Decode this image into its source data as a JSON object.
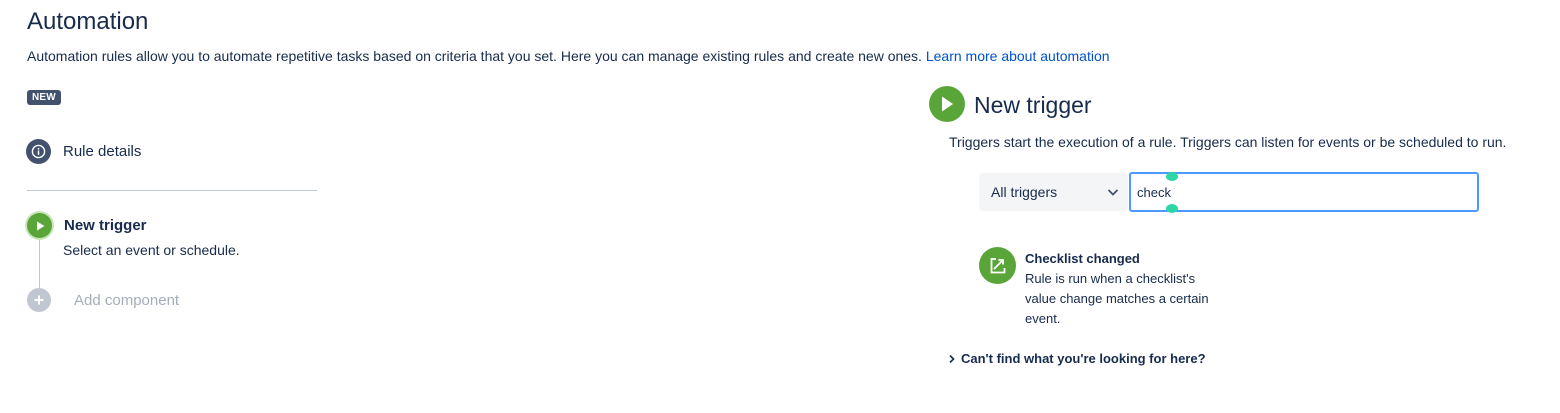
{
  "page": {
    "title": "Automation",
    "description": "Automation rules allow you to automate repetitive tasks based on criteria that you set. Here you can manage existing rules and create new ones.",
    "learn_more_link": "Learn more about automation",
    "badge": "NEW"
  },
  "rule_builder": {
    "rule_details_label": "Rule details",
    "trigger_step": {
      "title": "New trigger",
      "subtitle": "Select an event or schedule."
    },
    "add_component_label": "Add component"
  },
  "trigger_panel": {
    "title": "New trigger",
    "description": "Triggers start the execution of a rule. Triggers can listen for events or be scheduled to run.",
    "filter_select_value": "All triggers",
    "search_value": "check",
    "results": [
      {
        "title": "Checklist changed",
        "description": "Rule is run when a checklist's value change matches a certain event.",
        "icon": "checklist-edit-icon"
      }
    ],
    "cant_find_label": "Can't find what you're looking for here?"
  },
  "colors": {
    "accent_green": "#5aa53a",
    "link_blue": "#0052cc",
    "focus_border": "#4c9aff",
    "badge_bg": "#42526e"
  }
}
